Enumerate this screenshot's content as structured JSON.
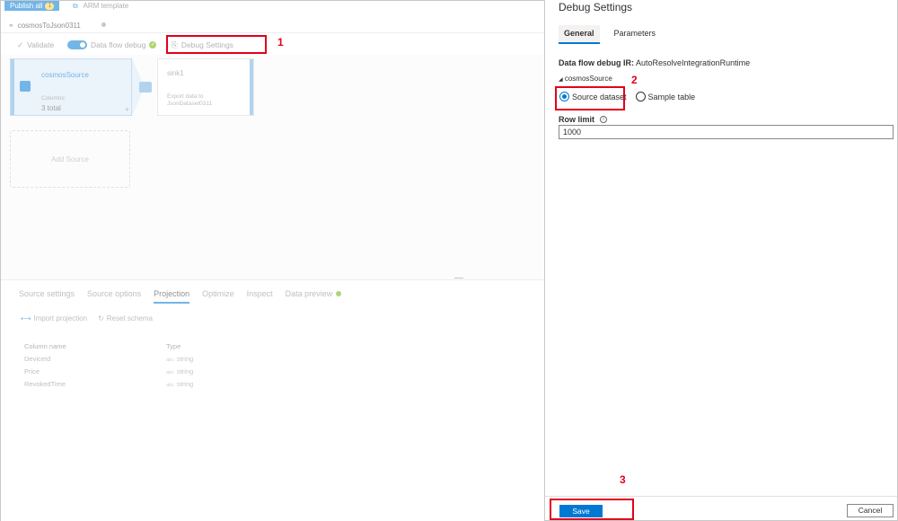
{
  "topbar": {
    "publish_label": "Publish all",
    "publish_count": "1",
    "arm_label": "ARM template"
  },
  "tab": {
    "name": "cosmosToJson0311"
  },
  "toolbar": {
    "validate": "Validate",
    "debug_label": "Data flow debug",
    "debug_settings": "Debug Settings"
  },
  "canvas": {
    "source": {
      "name": "cosmosSource",
      "sub": "Columns:",
      "value": "3 total"
    },
    "sink": {
      "name": "sink1",
      "desc_line1": "Export data to",
      "desc_line2": "JsonDataset0311"
    },
    "add_source": "Add Source"
  },
  "bottom": {
    "tabs": [
      "Source settings",
      "Source options",
      "Projection",
      "Optimize",
      "Inspect",
      "Data preview"
    ],
    "actions": {
      "import": "Import projection",
      "reset": "Reset schema"
    },
    "schema": {
      "headers": [
        "Column name",
        "Type"
      ],
      "rows": [
        {
          "name": "DeviceId",
          "type": "string"
        },
        {
          "name": "Price",
          "type": "string"
        },
        {
          "name": "RevokedTime",
          "type": "string"
        }
      ],
      "type_prefix": "abc"
    }
  },
  "panel": {
    "title": "Debug Settings",
    "tabs": [
      "General",
      "Parameters"
    ],
    "ir_label": "Data flow debug IR:",
    "ir_value": "AutoResolveIntegrationRuntime",
    "section": "cosmosSource",
    "radio_source": "Source dataset",
    "radio_sample": "Sample table",
    "row_limit_label": "Row limit",
    "row_limit_value": "1000",
    "save": "Save",
    "cancel": "Cancel"
  },
  "annotations": {
    "step1": "1",
    "step2": "2",
    "step3": "3"
  },
  "colors": {
    "accent": "#0078d4",
    "highlight": "#e3001b",
    "success": "#6bb700"
  }
}
